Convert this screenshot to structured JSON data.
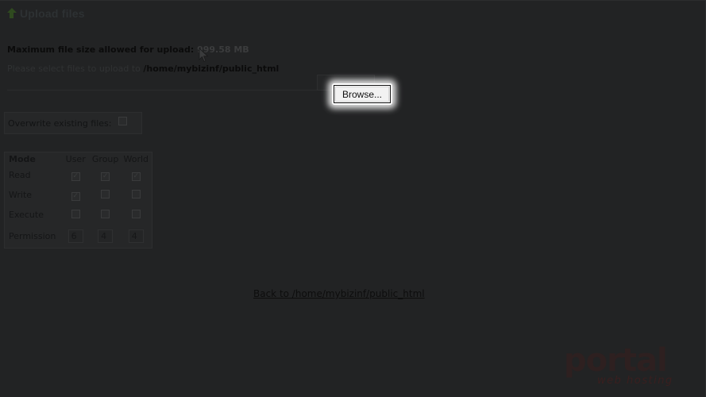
{
  "header": {
    "title": "Upload files",
    "icon": "upload-arrow-icon"
  },
  "upload": {
    "max_label": "Maximum file size allowed for upload:",
    "max_value": "999.58 MB",
    "select_prefix": "Please select files to upload to",
    "target_path": "/home/mybizinf/public_html",
    "browse_label": "Browse..."
  },
  "overwrite": {
    "label": "Overwrite existing files:",
    "checked": false
  },
  "permissions": {
    "headers": [
      "Mode",
      "User",
      "Group",
      "World"
    ],
    "rows": [
      {
        "label": "Read",
        "user": true,
        "group": true,
        "world": true
      },
      {
        "label": "Write",
        "user": true,
        "group": false,
        "world": false
      },
      {
        "label": "Execute",
        "user": false,
        "group": false,
        "world": false
      }
    ],
    "permission_label": "Permission",
    "values": [
      "6",
      "4",
      "4"
    ]
  },
  "back_link": "Back to /home/mybizinf/public_html",
  "logo": {
    "main": "portal",
    "sub": "web hosting"
  },
  "colors": {
    "background": "#222324",
    "glow": "#ffffff",
    "logo_accent": "#3b1c1c"
  }
}
